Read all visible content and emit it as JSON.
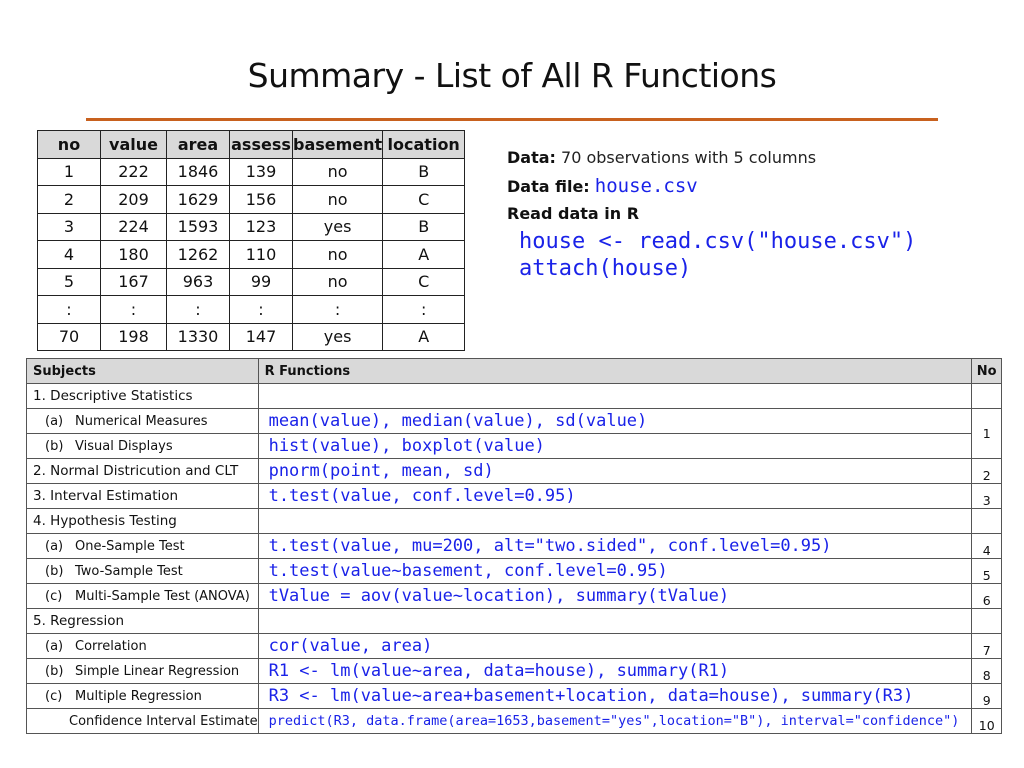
{
  "title": "Summary - List of All R Functions",
  "colors": {
    "rule": "#c8611e",
    "code": "#1a22e8",
    "header_bg": "#d9d9d9"
  },
  "data_table": {
    "headers": [
      "no",
      "value",
      "area",
      "assess",
      "basement",
      "location"
    ],
    "rows": [
      [
        "1",
        "222",
        "1846",
        "139",
        "no",
        "B"
      ],
      [
        "2",
        "209",
        "1629",
        "156",
        "no",
        "C"
      ],
      [
        "3",
        "224",
        "1593",
        "123",
        "yes",
        "B"
      ],
      [
        "4",
        "180",
        "1262",
        "110",
        "no",
        "A"
      ],
      [
        "5",
        "167",
        "963",
        "99",
        "no",
        "C"
      ],
      [
        ":",
        ":",
        ":",
        ":",
        ":",
        ":"
      ],
      [
        "70",
        "198",
        "1330",
        "147",
        "yes",
        "A"
      ]
    ]
  },
  "info": {
    "data_label": "Data:",
    "data_text": "70 observations with 5 columns",
    "file_label": "Data file:",
    "file_name": "house.csv",
    "read_label": "Read data in R",
    "code_line1": "house <- read.csv(\"house.csv\")",
    "code_line2": "attach(house)"
  },
  "subjects_table": {
    "headers": {
      "subjects": "Subjects",
      "functions": "R Functions",
      "no": "No"
    },
    "rows": [
      {
        "letter": "",
        "subject": "1. Descriptive Statistics",
        "code": "",
        "no": ""
      },
      {
        "letter": "(a)",
        "subject": "Numerical Measures",
        "code": "mean(value), median(value), sd(value)",
        "no": "1"
      },
      {
        "letter": "(b)",
        "subject": "Visual Displays",
        "code": "hist(value),  boxplot(value)",
        "no": ""
      },
      {
        "letter": "",
        "subject": "2. Normal Districution and CLT",
        "code": "pnorm(point, mean, sd)",
        "no": "2"
      },
      {
        "letter": "",
        "subject": "3. Interval Estimation",
        "code": "t.test(value, conf.level=0.95)",
        "no": "3"
      },
      {
        "letter": "",
        "subject": "4. Hypothesis Testing",
        "code": "",
        "no": ""
      },
      {
        "letter": "(a)",
        "subject": "One-Sample Test",
        "code": "t.test(value, mu=200, alt=\"two.sided\", conf.level=0.95)",
        "no": "4"
      },
      {
        "letter": "(b)",
        "subject": "Two-Sample Test",
        "code": "t.test(value~basement, conf.level=0.95)",
        "no": "5"
      },
      {
        "letter": "(c)",
        "subject": "Multi-Sample Test (ANOVA)",
        "code": "tValue = aov(value~location),  summary(tValue)",
        "no": "6"
      },
      {
        "letter": "",
        "subject": "5. Regression",
        "code": "",
        "no": ""
      },
      {
        "letter": "(a)",
        "subject": "Correlation",
        "code": "cor(value, area)",
        "no": "7"
      },
      {
        "letter": "(b)",
        "subject": "Simple Linear Regression",
        "code": "R1 <- lm(value~area, data=house),  summary(R1)",
        "no": "8"
      },
      {
        "letter": "(c)",
        "subject": "Multiple Regression",
        "code": "R3 <- lm(value~area+basement+location, data=house), summary(R3)",
        "no": "9"
      },
      {
        "letter": "",
        "subject": "Confidence Interval Estimate",
        "code": "predict(R3, data.frame(area=1653,basement=\"yes\",location=\"B\"), interval=\"confidence\")",
        "no": "10"
      }
    ]
  }
}
